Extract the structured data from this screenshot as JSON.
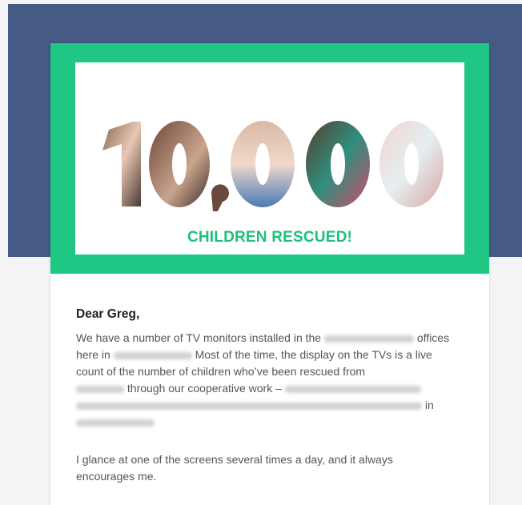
{
  "email": {
    "hero": {
      "big_number": "10,000",
      "headline": "CHILDREN RESCUED!"
    },
    "greeting": "Dear Greg,",
    "paragraph1": {
      "part1": "We have a number of TV monitors installed in the",
      "part2": "offices here in",
      "part3": "Most of the time, the display on the TVs is a live count of the number of children who’ve been rescued from",
      "part4": "through our cooperative work –",
      "part5": "in"
    },
    "paragraph2": "I glance at one of the screens several times a day, and it always encourages me."
  },
  "colors": {
    "top_band": "#455a84",
    "hero_green": "#1fc684",
    "headline_green": "#1fbf7c"
  }
}
